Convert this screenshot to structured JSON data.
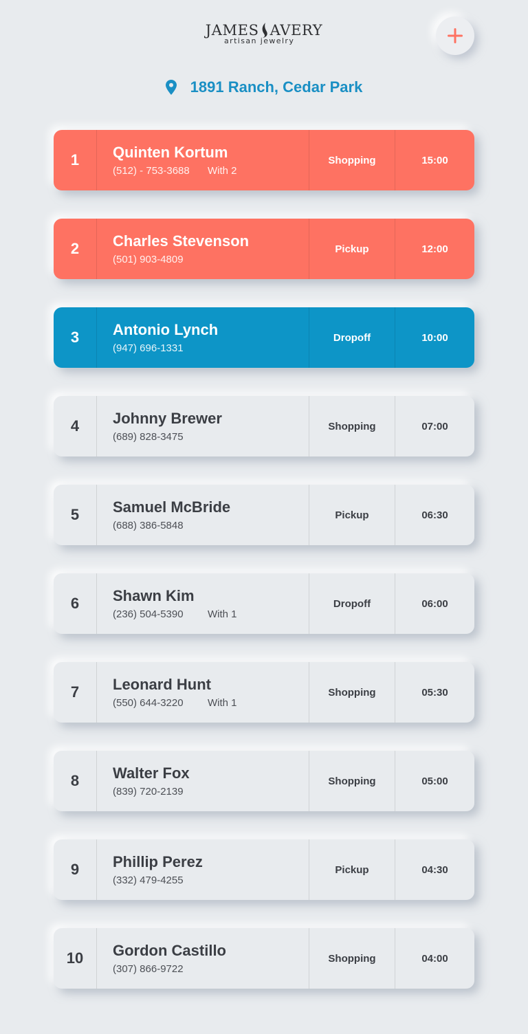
{
  "brand": {
    "name_left": "JAMES",
    "name_right": "AVERY",
    "tagline": "artisan jewelry"
  },
  "location": {
    "icon": "map-pin-icon",
    "label": "1891 Ranch, Cedar Park"
  },
  "add_button": {
    "icon": "plus-icon"
  },
  "colors": {
    "coral": "#fe7262",
    "blue": "#0d95c7",
    "neutral": "#e8ebee",
    "text_dark": "#3b3e44"
  },
  "queue": [
    {
      "position": "1",
      "name": "Quinten Kortum",
      "phone": "(512) - 753-3688",
      "party": "With 2",
      "type": "Shopping",
      "time": "15:00",
      "status": "coral"
    },
    {
      "position": "2",
      "name": "Charles Stevenson",
      "phone": "(501) 903-4809",
      "party": "",
      "type": "Pickup",
      "time": "12:00",
      "status": "coral"
    },
    {
      "position": "3",
      "name": "Antonio Lynch",
      "phone": "(947) 696-1331",
      "party": "",
      "type": "Dropoff",
      "time": "10:00",
      "status": "blue"
    },
    {
      "position": "4",
      "name": "Johnny Brewer",
      "phone": "(689) 828-3475",
      "party": "",
      "type": "Shopping",
      "time": "07:00",
      "status": "neutral"
    },
    {
      "position": "5",
      "name": "Samuel McBride",
      "phone": "(688) 386-5848",
      "party": "",
      "type": "Pickup",
      "time": "06:30",
      "status": "neutral"
    },
    {
      "position": "6",
      "name": "Shawn Kim",
      "phone": "(236) 504-5390",
      "party": "With 1",
      "type": "Dropoff",
      "time": "06:00",
      "status": "neutral"
    },
    {
      "position": "7",
      "name": "Leonard Hunt",
      "phone": "(550) 644-3220",
      "party": "With 1",
      "type": "Shopping",
      "time": "05:30",
      "status": "neutral"
    },
    {
      "position": "8",
      "name": "Walter Fox",
      "phone": "(839) 720-2139",
      "party": "",
      "type": "Shopping",
      "time": "05:00",
      "status": "neutral"
    },
    {
      "position": "9",
      "name": "Phillip Perez",
      "phone": "(332) 479-4255",
      "party": "",
      "type": "Pickup",
      "time": "04:30",
      "status": "neutral"
    },
    {
      "position": "10",
      "name": "Gordon Castillo",
      "phone": "(307) 866-9722",
      "party": "",
      "type": "Shopping",
      "time": "04:00",
      "status": "neutral"
    }
  ]
}
